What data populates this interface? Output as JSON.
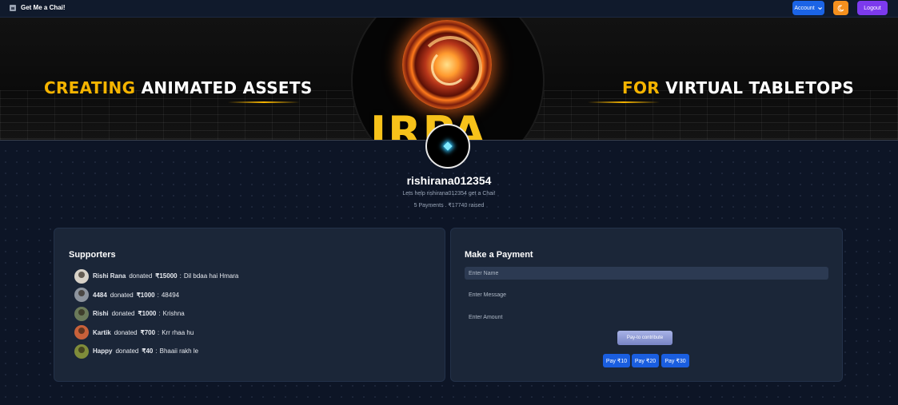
{
  "nav": {
    "brand": "Get Me a Chai!",
    "account_label": "Account",
    "logout_label": "Logout",
    "theme_icon": "moon-icon"
  },
  "banner": {
    "left_highlight": "CREATING",
    "left_text": "ANIMATED ASSETS",
    "right_highlight": "FOR",
    "right_text": "VIRTUAL TABLETOPS",
    "logo_text": "IRPA",
    "highlight_color": "#f5b400"
  },
  "profile": {
    "username": "rishirana012354",
    "tagline": "Lets help rishirana012354 get a Chai!",
    "stats": "5 Payments . ₹17740 raised"
  },
  "supporters": {
    "title": "Supporters",
    "items": [
      {
        "name": "Rishi Rana",
        "donated": "donated",
        "amount": "₹15000",
        "sep": ":",
        "message": "Dil bdaa hai Hmara",
        "avatar_color": "#d8d2c8"
      },
      {
        "name": "4484",
        "donated": "donated",
        "amount": "₹1000",
        "sep": ":",
        "message": "48494",
        "avatar_color": "#8d949e"
      },
      {
        "name": "Rishi",
        "donated": "donated",
        "amount": "₹1000",
        "sep": ":",
        "message": "Krishna",
        "avatar_color": "#6b7a5a"
      },
      {
        "name": "Kartik",
        "donated": "donated",
        "amount": "₹700",
        "sep": ":",
        "message": "Krr rhaa hu",
        "avatar_color": "#c8613a"
      },
      {
        "name": "Happy",
        "donated": "donated",
        "amount": "₹40",
        "sep": ":",
        "message": "Bhaaii rakh le",
        "avatar_color": "#7f8c3a"
      }
    ]
  },
  "payment": {
    "title": "Make a Payment",
    "name_placeholder": "Enter Name",
    "message_placeholder": "Enter Message",
    "amount_placeholder": "Enter Amount",
    "contribute_label": "Pay-to contribute",
    "quick": [
      "Pay ₹10",
      "Pay ₹20",
      "Pay ₹30"
    ]
  }
}
